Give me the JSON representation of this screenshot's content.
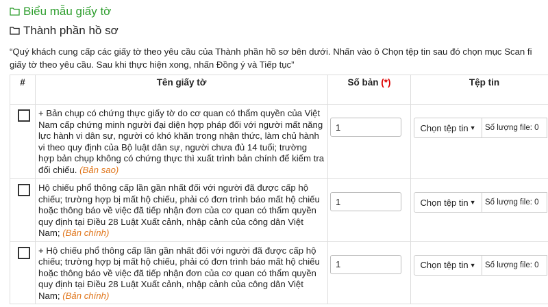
{
  "sections": {
    "forms_title": "Biểu mẫu giấy tờ",
    "dossier_title": "Thành phần hồ sơ"
  },
  "note": {
    "line1": "“Quý khách cung cấp các giấy tờ theo yêu cầu của Thành phần hồ sơ bên dưới. Nhấn vào ô Chọn tệp tin sau đó chọn mục Scan fi",
    "line2": "giấy tờ theo yêu cầu. Sau khi thực hiện xong, nhấn Đồng ý và Tiếp tục”"
  },
  "table": {
    "col_index": "#",
    "col_name": "Tên giấy tờ",
    "col_copies": "Số bản",
    "col_copies_required": "(*)",
    "col_file": "Tệp tin",
    "rows": [
      {
        "text": "+ Bản chụp có chứng thực giấy tờ do cơ quan có thẩm quyền của Việt Nam cấp chứng minh người đại diện hợp pháp đối với người mất năng lực hành vi dân sự, người có khó khăn trong nhận thức, làm chủ hành vi theo quy định của Bộ luật dân sự, người chưa đủ 14 tuổi; trường hợp bản chụp không có chứng thực thì xuất trình bản chính để kiểm tra đối chiếu.",
        "kind": "(Bản sao)",
        "copies": "1",
        "choose_label": "Chọn tệp tin",
        "file_count": "Số lượng file: 0"
      },
      {
        "text": "Hộ chiếu phổ thông cấp lần gần nhất đối với người đã được cấp hộ chiếu; trường hợp bị mất hộ chiếu, phải có đơn trình báo mất hộ chiếu hoặc thông báo về việc đã tiếp nhận đơn của cơ quan có thẩm quyền quy định tại Điều 28 Luật Xuất cảnh, nhập cảnh của công dân Việt Nam;",
        "kind": "(Bản chính)",
        "copies": "1",
        "choose_label": "Chọn tệp tin",
        "file_count": "Số lượng file: 0"
      },
      {
        "text": "+ Hộ chiếu phổ thông cấp lần gần nhất đối với người đã được cấp hộ chiếu; trường hợp bị mất hộ chiếu, phải có đơn trình báo mất hộ chiếu hoặc thông báo về việc đã tiếp nhận đơn của cơ quan có thẩm quyền quy định tại Điều 28 Luật Xuất cảnh, nhập cảnh của công dân Việt Nam;",
        "kind": "(Bản chính)",
        "copies": "1",
        "choose_label": "Chọn tệp tin",
        "file_count": "Số lượng file: 0"
      }
    ]
  },
  "icons": {
    "section": "folder-open-icon",
    "dropdown": "caret-down-icon"
  },
  "colors": {
    "accent_green": "#2e9e2e",
    "required_red": "#dd0000",
    "doc_kind_orange": "#e0761c"
  }
}
